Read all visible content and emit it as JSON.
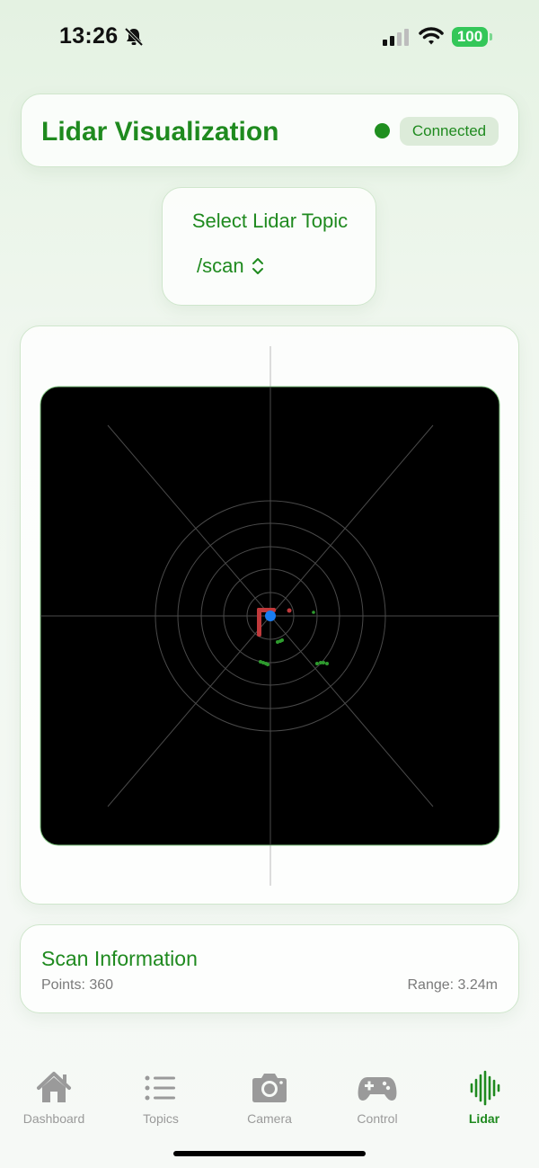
{
  "status_bar": {
    "time": "13:26",
    "battery": "100"
  },
  "header": {
    "title": "Lidar Visualization",
    "status": "Connected",
    "status_color": "#1f8f1f"
  },
  "topic_picker": {
    "title": "Select Lidar Topic",
    "selected": "/scan"
  },
  "scan_info": {
    "title": "Scan Information",
    "points": "Points: 360",
    "range": "Range: 3.24m"
  },
  "tabs": [
    {
      "label": "Dashboard",
      "icon": "house-icon",
      "active": false
    },
    {
      "label": "Topics",
      "icon": "list-icon",
      "active": false
    },
    {
      "label": "Camera",
      "icon": "camera-icon",
      "active": false
    },
    {
      "label": "Control",
      "icon": "gamepad-icon",
      "active": false
    },
    {
      "label": "Lidar",
      "icon": "waveform-icon",
      "active": true
    }
  ],
  "colors": {
    "accent": "#1f8a1f",
    "robot": "#1a7cf0",
    "obstacle_near": "#c0393b",
    "obstacle_far": "#2e9b2e"
  }
}
